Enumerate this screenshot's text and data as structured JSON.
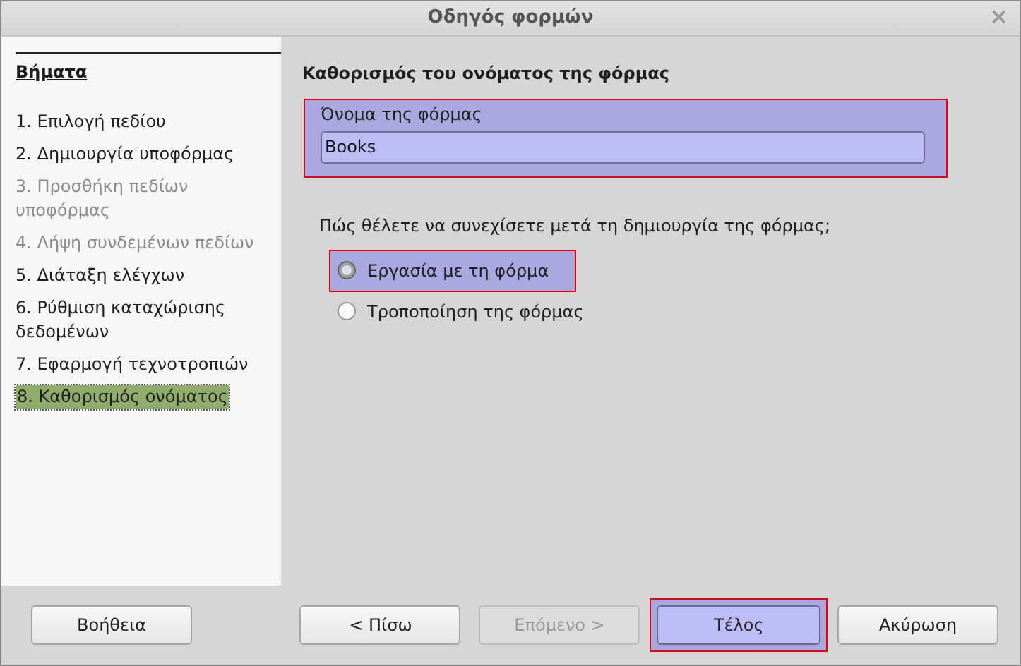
{
  "window": {
    "title": "Οδηγός φορμών",
    "close": "×"
  },
  "sidebar": {
    "heading": "Βήματα",
    "steps": [
      {
        "label": "1. Επιλογή πεδίου",
        "disabled": false,
        "selected": false
      },
      {
        "label": "2. Δημιουργία υποφόρμας",
        "disabled": false,
        "selected": false
      },
      {
        "label": "3. Προσθήκη πεδίων υποφόρμας",
        "disabled": true,
        "selected": false
      },
      {
        "label": "4. Λήψη συνδεμένων πεδίων",
        "disabled": true,
        "selected": false
      },
      {
        "label": "5. Διάταξη ελέγχων",
        "disabled": false,
        "selected": false
      },
      {
        "label": "6. Ρύθμιση καταχώρισης δεδομένων",
        "disabled": false,
        "selected": false
      },
      {
        "label": "7. Εφαρμογή τεχνοτροπιών",
        "disabled": false,
        "selected": false
      },
      {
        "label": "8. Καθορισμός ονόματος",
        "disabled": false,
        "selected": true
      }
    ]
  },
  "main": {
    "title": "Καθορισμός του ονόματος της φόρμας",
    "name_field": {
      "label": "Όνομα της φόρμας",
      "value": "Books",
      "highlighted": true
    },
    "question": "Πώς θέλετε να συνεχίσετε μετά τη δημιουργία της φόρμας;",
    "options": [
      {
        "label": "Εργασία με τη φόρμα",
        "selected": true,
        "highlighted": true
      },
      {
        "label": "Τροποποίηση της φόρμας",
        "selected": false,
        "highlighted": false
      }
    ]
  },
  "buttons": [
    {
      "label": "Βοήθεια",
      "disabled": false,
      "highlighted": false
    },
    {
      "label": "< Πίσω",
      "disabled": false,
      "highlighted": false
    },
    {
      "label": "Επόμενο >",
      "disabled": true,
      "highlighted": false
    },
    {
      "label": "Τέλος",
      "disabled": false,
      "highlighted": true
    },
    {
      "label": "Ακύρωση",
      "disabled": false,
      "highlighted": false
    }
  ]
}
